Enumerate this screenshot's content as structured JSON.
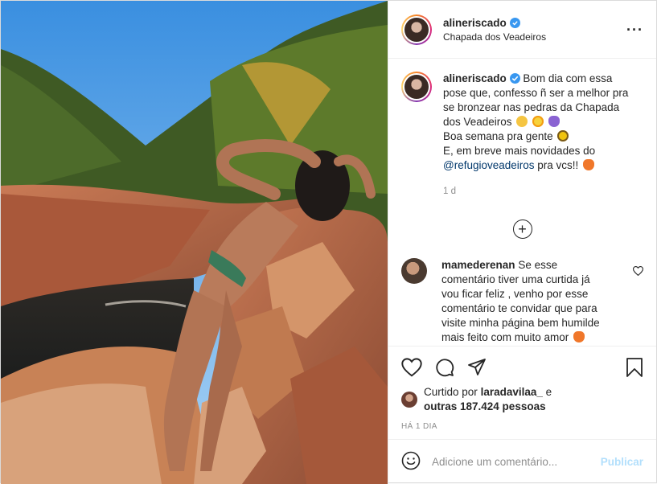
{
  "post": {
    "username": "alineriscado",
    "location": "Chapada dos Veadeiros",
    "more_icon": "more-horizontal-icon"
  },
  "caption": {
    "username": "alineriscado",
    "lines": [
      "Bom dia com essa",
      "pose que, confesso ñ ser a melhor pra",
      "se bronzear nas pedras da Chapada",
      "dos Veadeiros",
      "Boa semana pra gente",
      "E, em breve mais novidades do"
    ],
    "mention": "@refugioveadeiros",
    "mention_suffix": " pra vcs!!",
    "age": "1 d"
  },
  "comment": {
    "username": "mamederenan",
    "text_lines": [
      "Se esse",
      "comentário tiver uma curtida já",
      "vou ficar feliz , venho por esse",
      "comentário te convidar que para",
      "visite minha página bem humilde",
      "mais feito com muito amor"
    ]
  },
  "likes": {
    "prefix": "Curtido por",
    "user": "laradavilaa_",
    "joiner": "e",
    "others": "outras 187.424 pessoas"
  },
  "timestamp": "HÁ 1 DIA",
  "add_comment": {
    "placeholder": "Adicione um comentário...",
    "publish_label": "Publicar"
  },
  "colors": {
    "verified": "#3897f0",
    "mention": "#00376b",
    "publish_disabled": "#b2dffc",
    "muted": "#8e8e8e"
  }
}
